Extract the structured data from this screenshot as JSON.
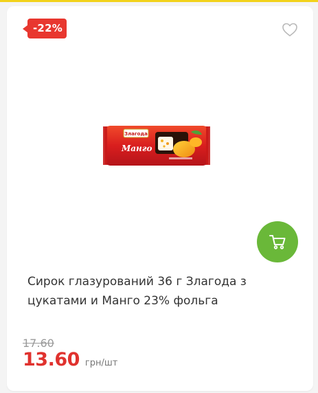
{
  "product": {
    "discount_badge": "-22%",
    "title": "Сирок глазурований 36 г Злагода з цукатами и Манго 23% фольга",
    "old_price": "17.60",
    "price": "13.60",
    "unit": "грн/шт",
    "image": {
      "brand_label": "Злагода",
      "flavor_label": "Манго"
    }
  },
  "icons": {
    "favorite": "heart-outline-icon",
    "cart": "cart-icon"
  },
  "colors": {
    "accent_yellow": "#f2d21b",
    "badge_red": "#e8372f",
    "price_red": "#e0322e",
    "cart_green": "#6ab839",
    "old_price_gray": "#9a9a9a"
  }
}
